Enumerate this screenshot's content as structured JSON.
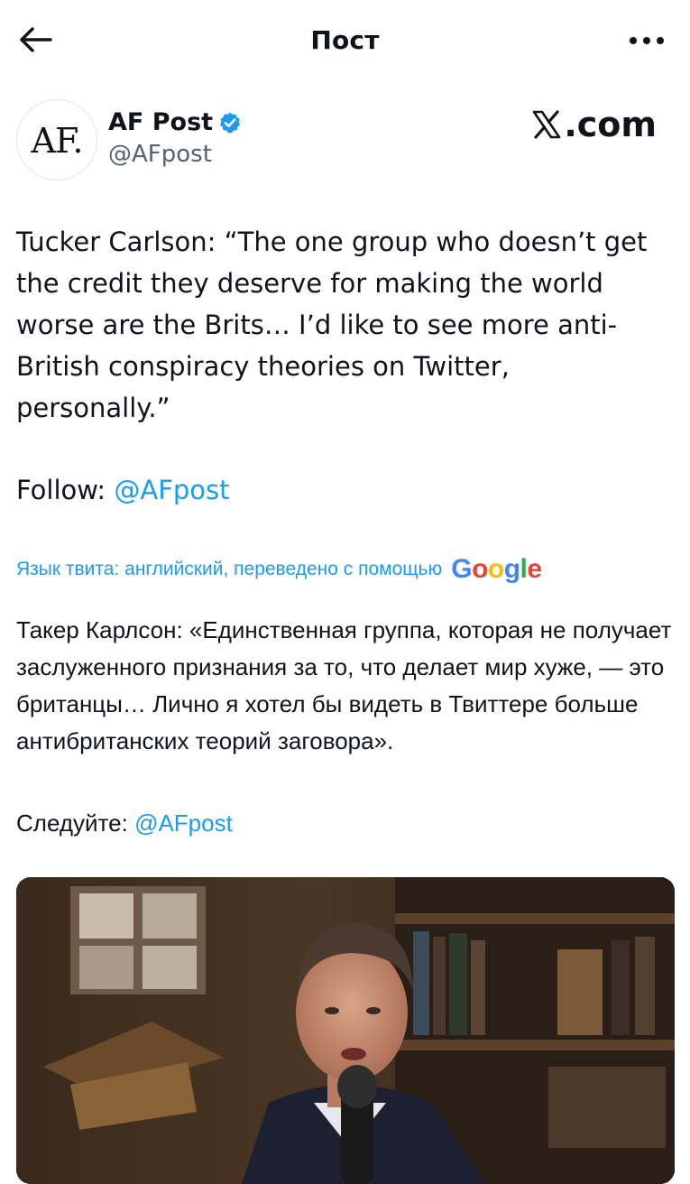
{
  "header": {
    "title": "Пост",
    "back_icon": "arrow-left-icon",
    "more_icon": "more-horizontal-icon"
  },
  "author": {
    "avatar_text": "AF.",
    "name": "AF Post",
    "handle": "@AFpost",
    "verified": true,
    "verified_color": "#1d9bf0",
    "source_label": ".com",
    "source_icon": "x-logo-icon"
  },
  "tweet": {
    "text": "Tucker Carlson: “The one group who doesn’t get the credit they deserve for making the world worse are the Brits… I’d like to see more anti-British conspiracy theories on Twitter, personally.”",
    "follow_label": "Follow: ",
    "follow_mention": "@AFpost"
  },
  "translation": {
    "notice": "Язык твита: английский, переведено с помощью",
    "provider_letters": [
      "G",
      "o",
      "o",
      "g",
      "l",
      "e"
    ],
    "text": "Такер Карлсон: «Единственная группа, которая не получает заслуженного признания за то, что делает мир хуже, — это британцы… Лично я хотел бы видеть в Твиттере больше антибританских теорий заговора».",
    "follow_label": "Следуйте: ",
    "follow_mention": "@AFpost"
  },
  "colors": {
    "link": "#1d9bf0",
    "text": "#0f1419",
    "secondary": "#536471"
  }
}
